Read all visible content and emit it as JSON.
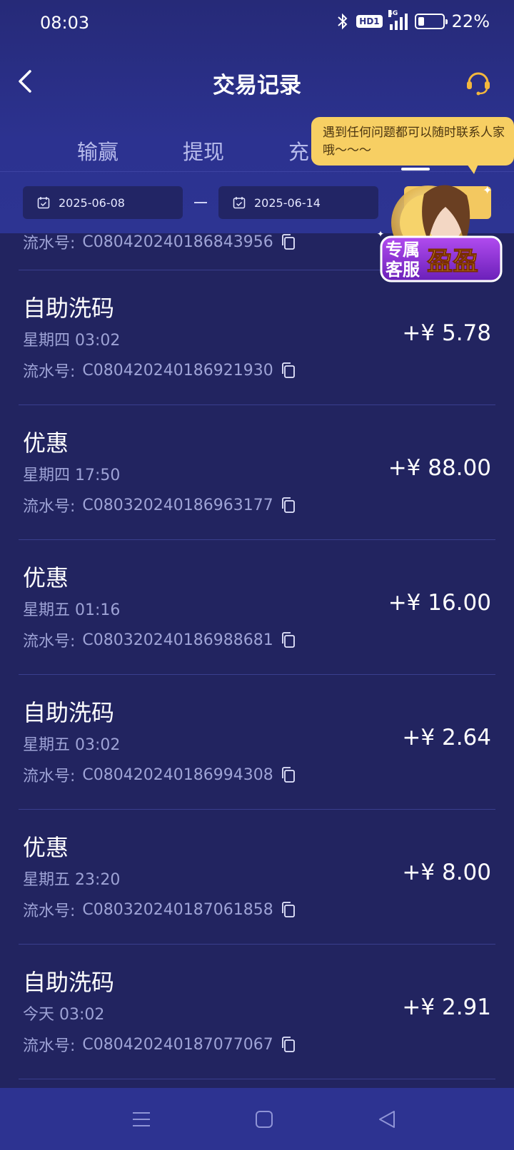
{
  "status_bar": {
    "time": "08:03",
    "hd_label": "HD1",
    "network": "4G",
    "battery": "22%"
  },
  "nav": {
    "title": "交易记录",
    "back_icon": "chevron-left-icon",
    "support_icon": "headset-icon"
  },
  "tabs": [
    {
      "label": "输赢"
    },
    {
      "label": "提现"
    },
    {
      "label": "充"
    }
  ],
  "filter": {
    "start_date": "2025-06-08",
    "end_date": "2025-06-14"
  },
  "tooltip": {
    "text": "遇到任何问题都可以随时联系人家哦～～～"
  },
  "promo": {
    "line1": "专属",
    "line2": "客服",
    "name": "盈盈"
  },
  "partial_item": {
    "serial_label": "流水号:",
    "serial": "C08042024018684395­6"
  },
  "transactions": [
    {
      "title": "自助洗码",
      "time": "星期四 03:02",
      "serial_label": "流水号:",
      "serial": "C080420240186921930",
      "amount": "+¥ 5.78"
    },
    {
      "title": "优惠",
      "time": "星期四 17:50",
      "serial_label": "流水号:",
      "serial": "C080320240186963177",
      "amount": "+¥ 88.00"
    },
    {
      "title": "优惠",
      "time": "星期五 01:16",
      "serial_label": "流水号:",
      "serial": "C080320240186988681",
      "amount": "+¥ 16.00"
    },
    {
      "title": "自助洗码",
      "time": "星期五 03:02",
      "serial_label": "流水号:",
      "serial": "C080420240186994308",
      "amount": "+¥ 2.64"
    },
    {
      "title": "优惠",
      "time": "星期五 23:20",
      "serial_label": "流水号:",
      "serial": "C080320240187061858",
      "amount": "+¥ 8.00"
    },
    {
      "title": "自助洗码",
      "time": "今天 03:02",
      "serial_label": "流水号:",
      "serial": "C080420240187077067",
      "amount": "+¥ 2.91"
    }
  ],
  "colors": {
    "background": "#222460",
    "header": "#2c3290",
    "accent": "#f3c860",
    "muted_text": "#9ea3d6"
  }
}
